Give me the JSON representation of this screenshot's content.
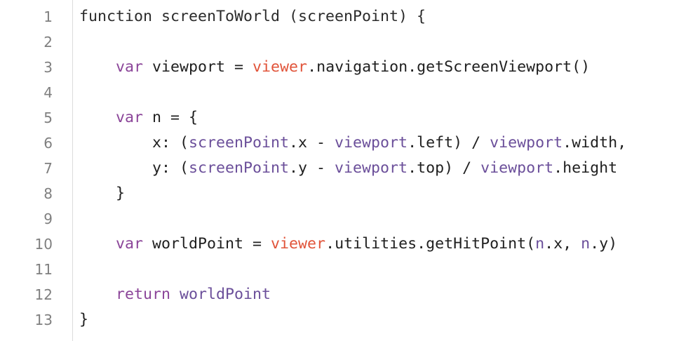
{
  "colors": {
    "keyword": "#8b4599",
    "global": "#e1543a",
    "variable": "#6b4f9a",
    "plain": "#1f1f1f",
    "line_number": "#7f7f7f",
    "gutter_border": "#dcdcdc",
    "background": "#ffffff"
  },
  "editor": {
    "lines": [
      {
        "number": "1",
        "tokens": [
          {
            "type": "fn",
            "text": "function screenToWorld (screenPoint) {"
          }
        ]
      },
      {
        "number": "2",
        "tokens": []
      },
      {
        "number": "3",
        "tokens": [
          {
            "type": "plain",
            "text": "    "
          },
          {
            "type": "kw",
            "text": "var"
          },
          {
            "type": "plain",
            "text": " viewport = "
          },
          {
            "type": "global",
            "text": "viewer"
          },
          {
            "type": "plain",
            "text": ".navigation.getScreenViewport()"
          }
        ]
      },
      {
        "number": "4",
        "tokens": []
      },
      {
        "number": "5",
        "tokens": [
          {
            "type": "plain",
            "text": "    "
          },
          {
            "type": "kw",
            "text": "var"
          },
          {
            "type": "plain",
            "text": " n = {"
          }
        ]
      },
      {
        "number": "6",
        "tokens": [
          {
            "type": "plain",
            "text": "        x: ("
          },
          {
            "type": "var",
            "text": "screenPoint"
          },
          {
            "type": "plain",
            "text": ".x - "
          },
          {
            "type": "var",
            "text": "viewport"
          },
          {
            "type": "plain",
            "text": ".left) / "
          },
          {
            "type": "var",
            "text": "viewport"
          },
          {
            "type": "plain",
            "text": ".width,"
          }
        ]
      },
      {
        "number": "7",
        "tokens": [
          {
            "type": "plain",
            "text": "        y: ("
          },
          {
            "type": "var",
            "text": "screenPoint"
          },
          {
            "type": "plain",
            "text": ".y - "
          },
          {
            "type": "var",
            "text": "viewport"
          },
          {
            "type": "plain",
            "text": ".top) / "
          },
          {
            "type": "var",
            "text": "viewport"
          },
          {
            "type": "plain",
            "text": ".height"
          }
        ]
      },
      {
        "number": "8",
        "tokens": [
          {
            "type": "plain",
            "text": "    }"
          }
        ]
      },
      {
        "number": "9",
        "tokens": []
      },
      {
        "number": "10",
        "tokens": [
          {
            "type": "plain",
            "text": "    "
          },
          {
            "type": "kw",
            "text": "var"
          },
          {
            "type": "plain",
            "text": " worldPoint = "
          },
          {
            "type": "global",
            "text": "viewer"
          },
          {
            "type": "plain",
            "text": ".utilities.getHitPoint("
          },
          {
            "type": "var",
            "text": "n"
          },
          {
            "type": "plain",
            "text": ".x, "
          },
          {
            "type": "var",
            "text": "n"
          },
          {
            "type": "plain",
            "text": ".y)"
          }
        ]
      },
      {
        "number": "11",
        "tokens": []
      },
      {
        "number": "12",
        "tokens": [
          {
            "type": "plain",
            "text": "    "
          },
          {
            "type": "kw",
            "text": "return"
          },
          {
            "type": "plain",
            "text": " "
          },
          {
            "type": "var",
            "text": "worldPoint"
          }
        ]
      },
      {
        "number": "13",
        "tokens": [
          {
            "type": "plain",
            "text": "}"
          }
        ]
      }
    ]
  }
}
